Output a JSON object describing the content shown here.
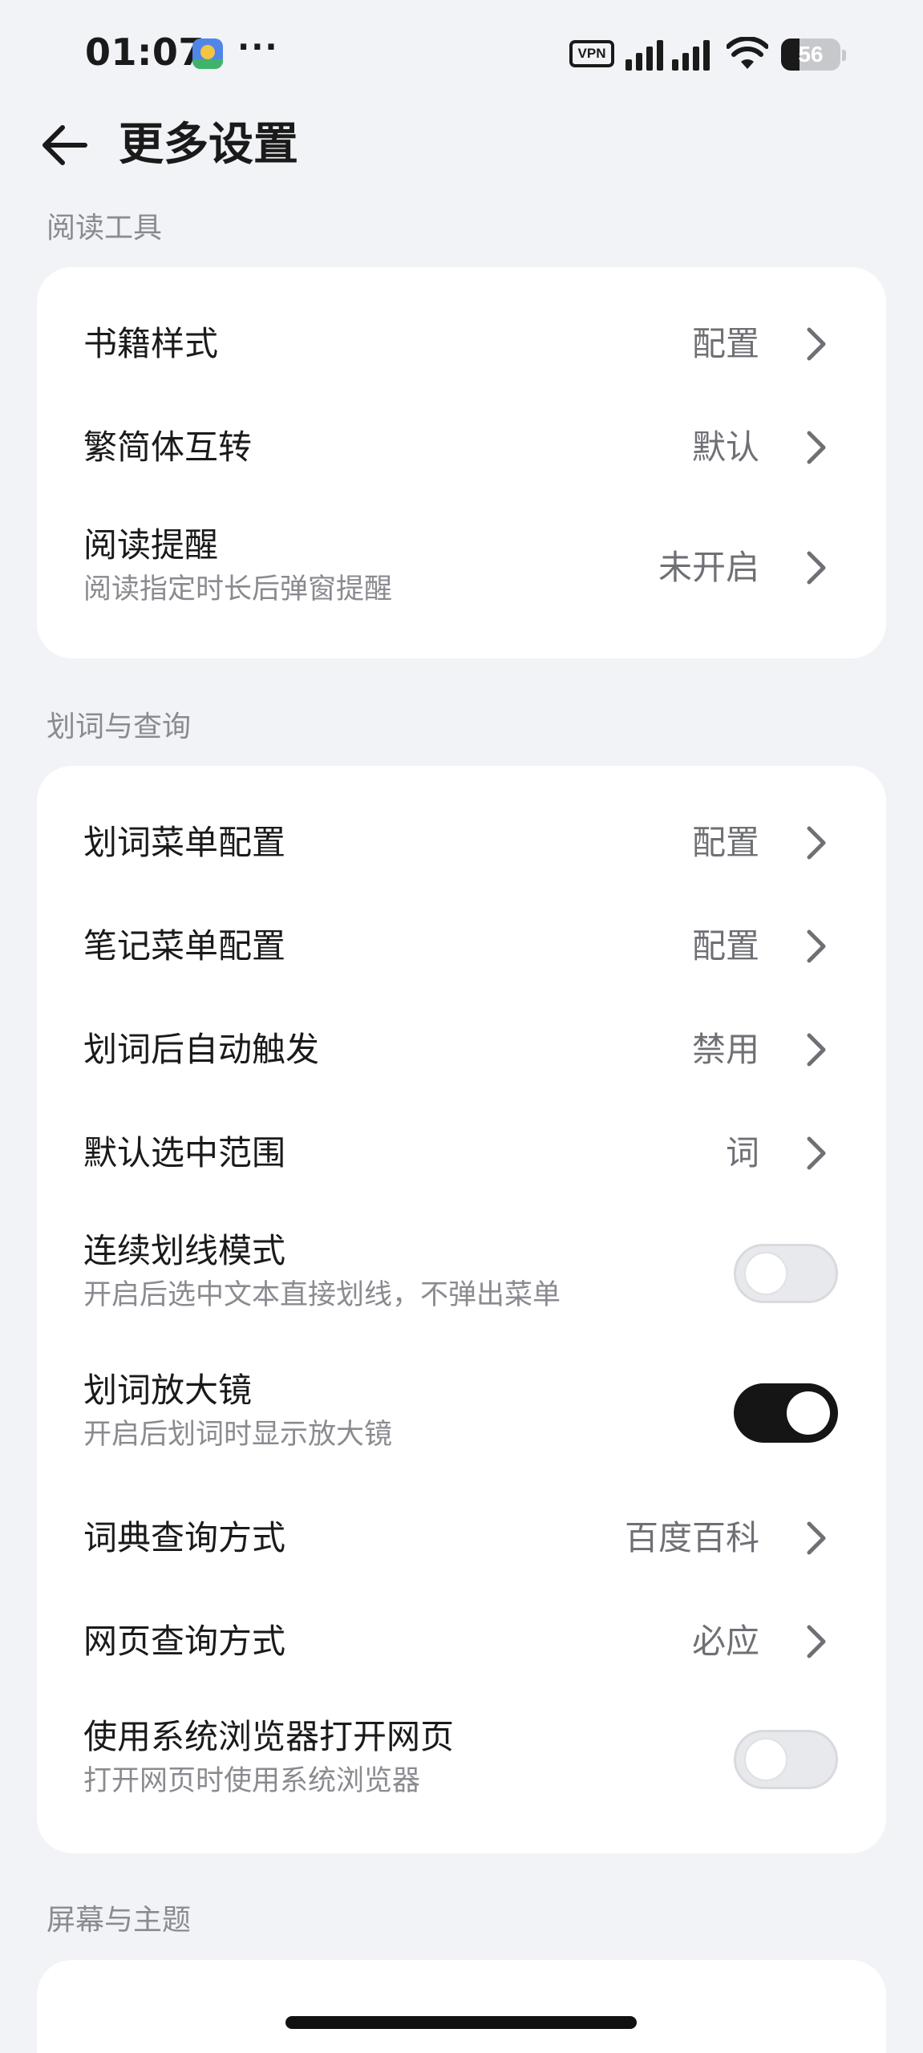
{
  "status_bar": {
    "time": "01:07",
    "more": "···",
    "vpn": "VPN",
    "battery": "56",
    "battery_level_percent": 56
  },
  "header": {
    "title": "更多设置"
  },
  "sections": [
    {
      "label": "阅读工具",
      "items": [
        {
          "title": "书籍样式",
          "value": "配置"
        },
        {
          "title": "繁简体互转",
          "value": "默认"
        },
        {
          "title": "阅读提醒",
          "subtitle": "阅读指定时长后弹窗提醒",
          "value": "未开启"
        }
      ]
    },
    {
      "label": "划词与查询",
      "items": [
        {
          "title": "划词菜单配置",
          "value": "配置"
        },
        {
          "title": "笔记菜单配置",
          "value": "配置"
        },
        {
          "title": "划词后自动触发",
          "value": "禁用"
        },
        {
          "title": "默认选中范围",
          "value": "词"
        },
        {
          "title": "连续划线模式",
          "subtitle": "开启后选中文本直接划线，不弹出菜单",
          "toggle": false
        },
        {
          "title": "划词放大镜",
          "subtitle": "开启后划词时显示放大镜",
          "toggle": true
        },
        {
          "title": "词典查询方式",
          "value": "百度百科"
        },
        {
          "title": "网页查询方式",
          "value": "必应"
        },
        {
          "title": "使用系统浏览器打开网页",
          "subtitle": "打开网页时使用系统浏览器",
          "toggle": false
        }
      ]
    },
    {
      "label": "屏幕与主题",
      "items": []
    }
  ]
}
